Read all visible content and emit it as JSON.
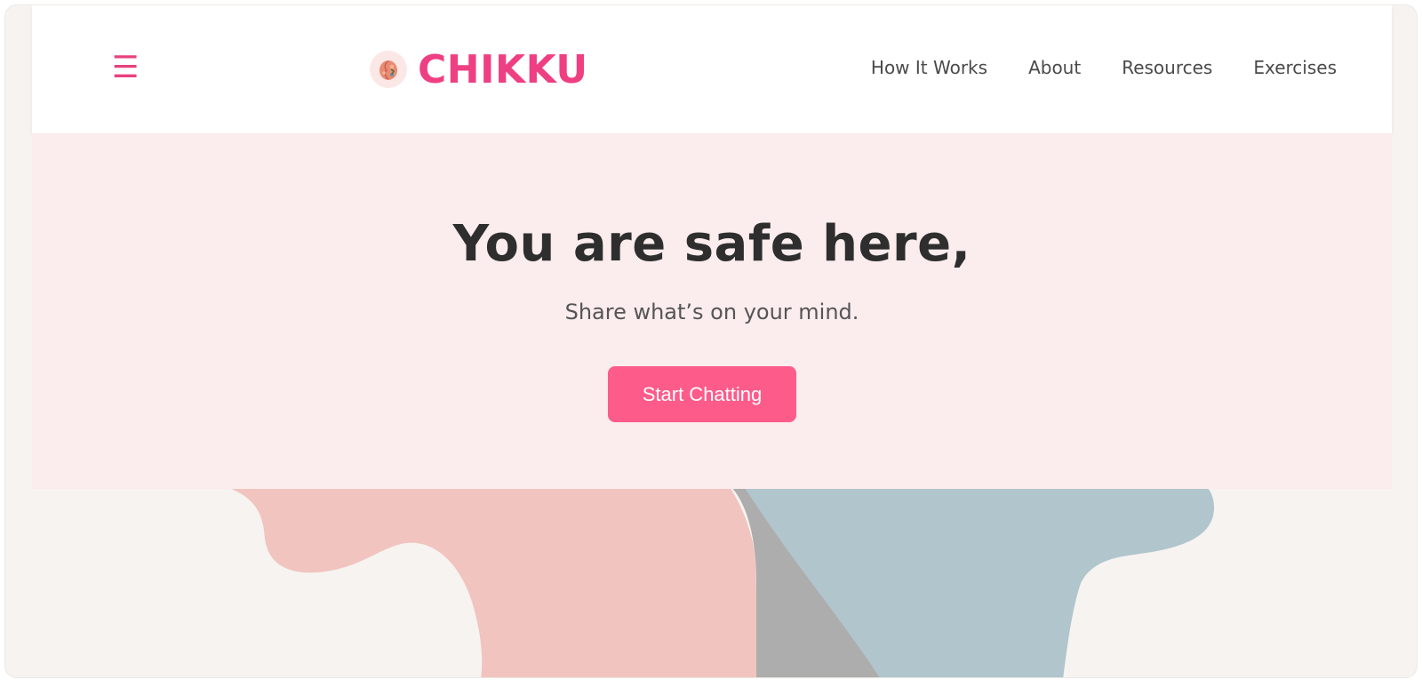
{
  "brand": {
    "name": "CHIKKU",
    "logo_icon": "brain-icon",
    "color": "#ef3f83"
  },
  "menu": {
    "icon": "hamburger-menu-icon",
    "glyph": "☰"
  },
  "nav": {
    "items": [
      {
        "label": "How It Works"
      },
      {
        "label": "About"
      },
      {
        "label": "Resources"
      },
      {
        "label": "Exercises"
      }
    ]
  },
  "hero": {
    "title": "You are safe here,",
    "subtitle": "Share what’s on your mind.",
    "cta_label": "Start Chatting",
    "background": "#fbeced",
    "cta_color": "#fd5b8a"
  }
}
